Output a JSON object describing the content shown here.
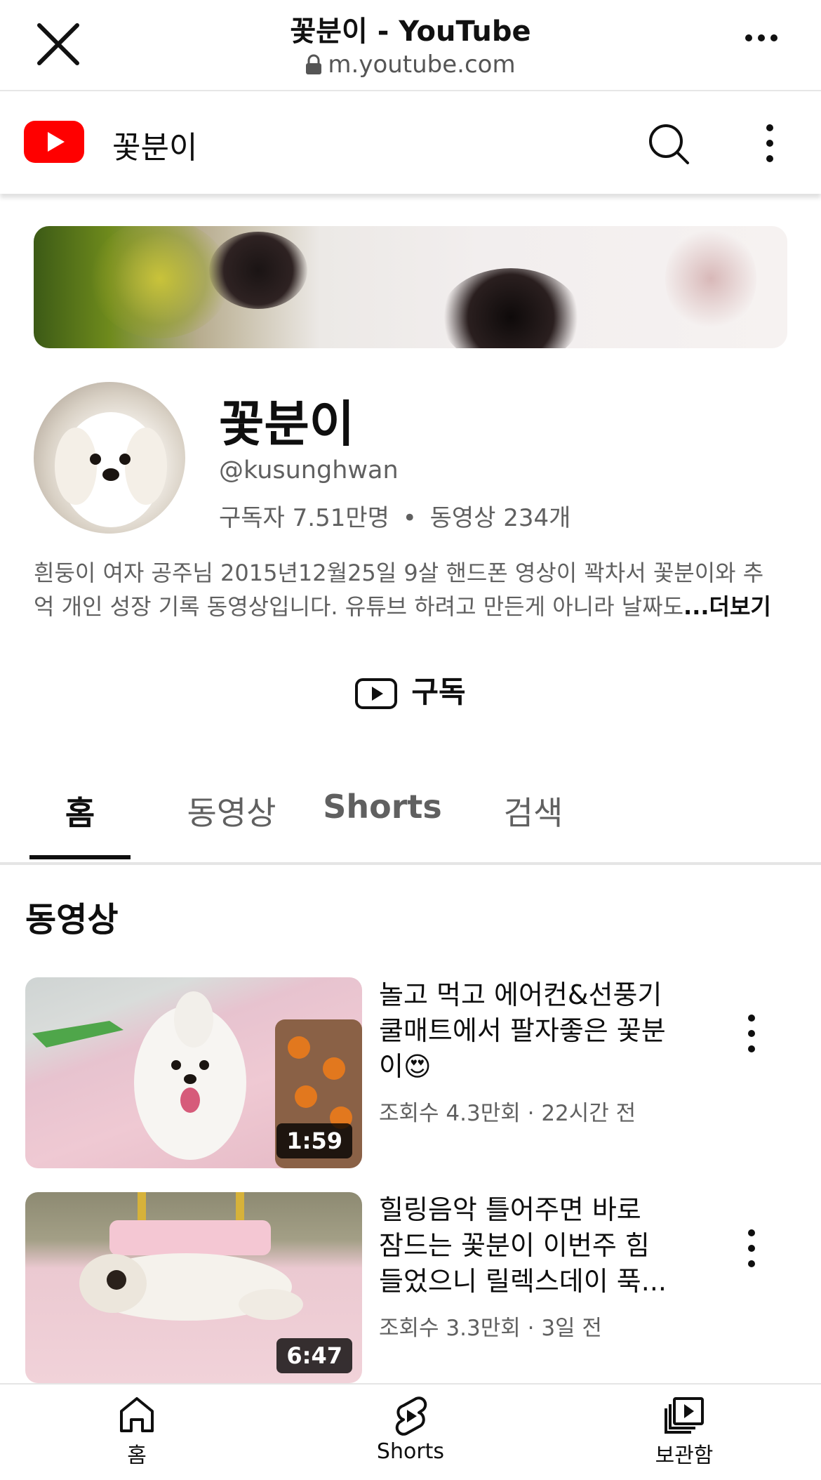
{
  "browser": {
    "title": "꽃분이 - YouTube",
    "url": "m.youtube.com",
    "close_icon": "close-icon",
    "more_icon": "more-horizontal-icon"
  },
  "header": {
    "channel": "꽃분이",
    "logo_icon": "youtube-logo-icon",
    "search_icon": "search-icon",
    "more_icon": "more-vertical-icon",
    "brand_color": "#ff0000"
  },
  "channel": {
    "name": "꽃분이",
    "handle": "@kusunghwan",
    "subscribers": "구독자 7.51만명",
    "separator": "•",
    "videos_count": "동영상 234개",
    "description_line1": "흰둥이 여자 공주님 2015년12월25일 9살 핸드폰 영상이 꽉차서 꽃분이와 추",
    "description_line2": "억 개인 성장 기록 동영상입니다. 유튜브 하려고 만든게 아니라 날짜도",
    "more": "...더보기",
    "subscribe": "구독"
  },
  "tabs": [
    {
      "label": "홈",
      "active": true
    },
    {
      "label": "동영상",
      "active": false
    },
    {
      "label": "Shorts",
      "active": false
    },
    {
      "label": "검색",
      "active": false
    }
  ],
  "section": {
    "title": "동영상"
  },
  "videos": [
    {
      "title_line1": "놀고 먹고 에어컨&선풍기",
      "title_line2": "쿨매트에서 팔자좋은 꽃분",
      "title_line3": "이😍",
      "meta": "조회수 4.3만회 · 22시간 전",
      "duration": "1:59"
    },
    {
      "title_line1": "힐링음악 틀어주면 바로",
      "title_line2": "잠드는 꽃분이 이번주 힘",
      "title_line3": "들었으니 릴렉스데이 푹...",
      "meta": "조회수 3.3만회 · 3일 전",
      "duration": "6:47"
    }
  ],
  "bottom_nav": [
    {
      "label": "홈",
      "icon": "home-icon"
    },
    {
      "label": "Shorts",
      "icon": "shorts-icon"
    },
    {
      "label": "보관함",
      "icon": "library-icon"
    }
  ]
}
